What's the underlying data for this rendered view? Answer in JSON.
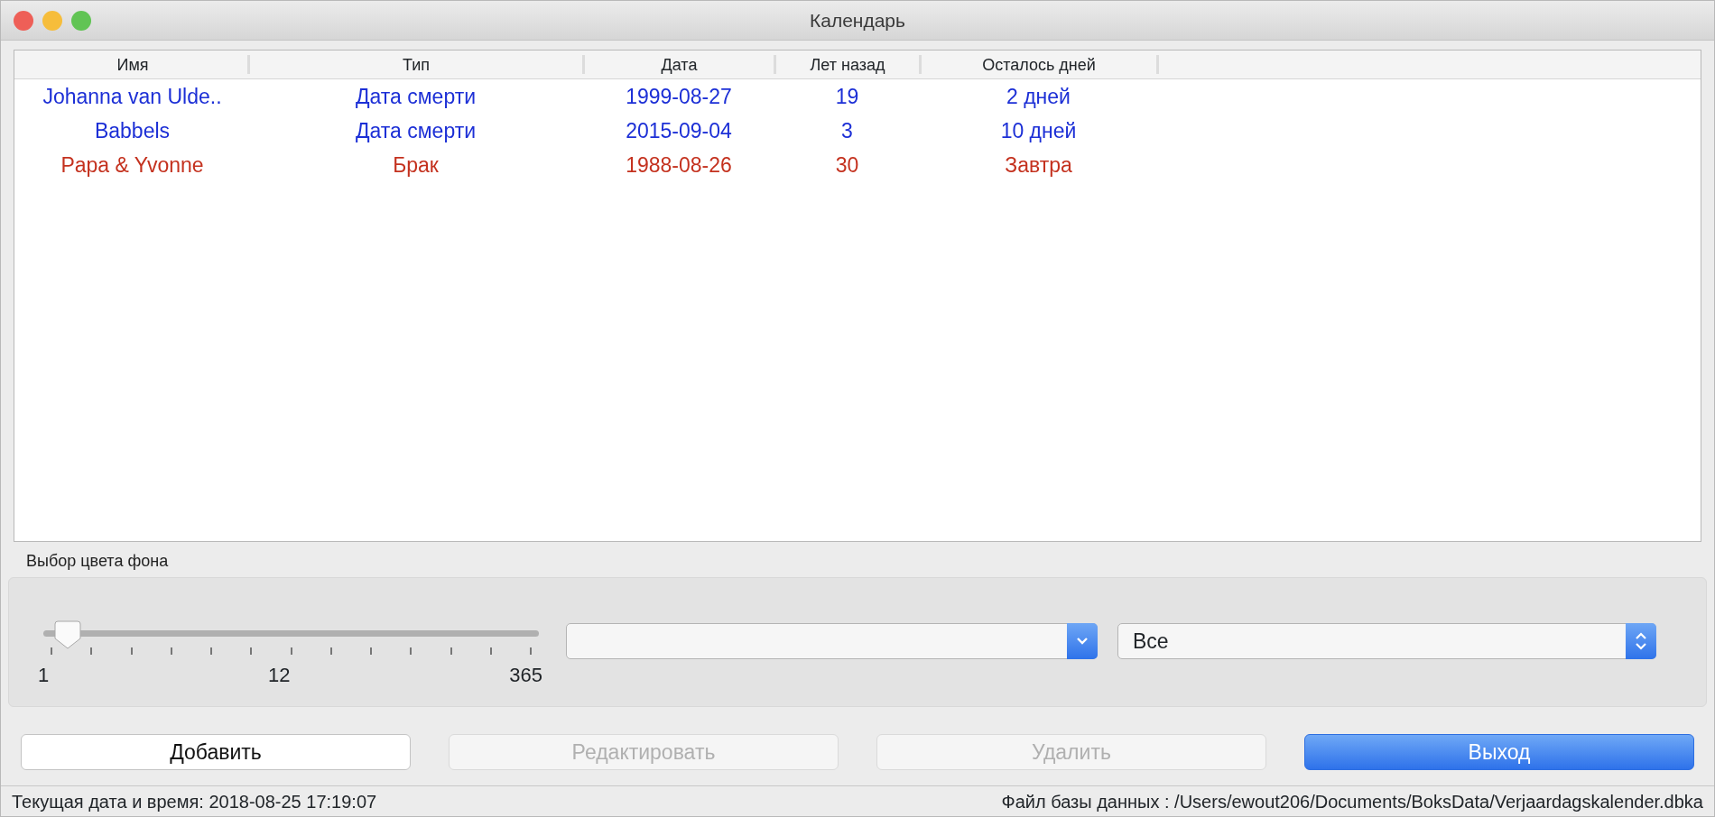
{
  "window": {
    "title": "Календарь"
  },
  "table": {
    "columns": [
      "Имя",
      "Тип",
      "Дата",
      "Лет назад",
      "Осталось дней"
    ],
    "rows": [
      {
        "cells": [
          "Johanna van Ulde..",
          "Дата смерти",
          "1999-08-27",
          "19",
          "2 дней"
        ],
        "color": "#1c2fd6"
      },
      {
        "cells": [
          "Babbels",
          "Дата смерти",
          "2015-09-04",
          "3",
          "10 дней"
        ],
        "color": "#1c2fd6"
      },
      {
        "cells": [
          "Papa & Yvonne",
          "Брак",
          "1988-08-26",
          "30",
          "Завтра"
        ],
        "color": "#c4311e"
      }
    ]
  },
  "background": {
    "label": "Выбор цвета фона",
    "slider": {
      "level": 0.05,
      "tick_labels": [
        "1",
        "12",
        "365"
      ]
    },
    "selects": [
      {
        "kind": "dropdown"
      },
      {
        "kind": "stepper",
        "value": "Все"
      }
    ]
  },
  "buttons": [
    {
      "label": "Добавить",
      "disabled": false,
      "default": false
    },
    {
      "label": "Редактировать",
      "disabled": true,
      "default": false
    },
    {
      "label": "Удалить",
      "disabled": true,
      "default": false
    },
    {
      "label": "Выход",
      "disabled": false,
      "default": true
    }
  ],
  "status_bar": {
    "left": "Текущая дата и время: 2018-08-25 17:19:07",
    "right": "Файл базы данных : /Users/ewout206/Documents/BoksData/Verjaardagskalender.dbka"
  }
}
